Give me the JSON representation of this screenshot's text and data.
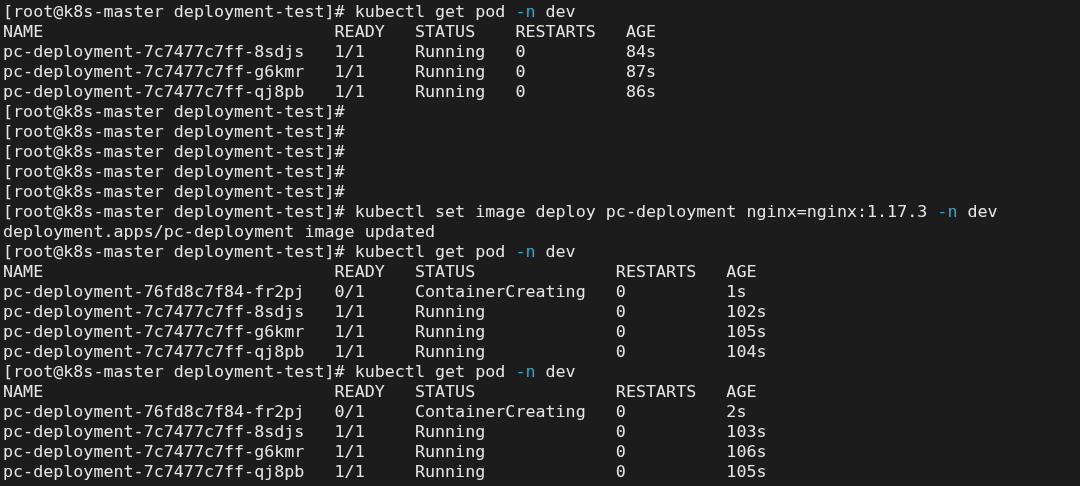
{
  "lines": [
    {
      "kind": "prompt",
      "prompt": "[root@k8s-master deployment-test]#",
      "tokens": [
        {
          "text": "kubectl",
          "kind": "plain"
        },
        {
          "text": "get",
          "kind": "plain"
        },
        {
          "text": "pod",
          "kind": "plain"
        },
        {
          "text": "-n",
          "kind": "flag"
        },
        {
          "text": "dev",
          "kind": "plain"
        }
      ]
    },
    {
      "kind": "output",
      "text": "NAME                             READY   STATUS    RESTARTS   AGE"
    },
    {
      "kind": "output",
      "text": "pc-deployment-7c7477c7ff-8sdjs   1/1     Running   0          84s"
    },
    {
      "kind": "output",
      "text": "pc-deployment-7c7477c7ff-g6kmr   1/1     Running   0          87s"
    },
    {
      "kind": "output",
      "text": "pc-deployment-7c7477c7ff-qj8pb   1/1     Running   0          86s"
    },
    {
      "kind": "prompt",
      "prompt": "[root@k8s-master deployment-test]#"
    },
    {
      "kind": "prompt",
      "prompt": "[root@k8s-master deployment-test]#"
    },
    {
      "kind": "prompt",
      "prompt": "[root@k8s-master deployment-test]#"
    },
    {
      "kind": "prompt",
      "prompt": "[root@k8s-master deployment-test]#"
    },
    {
      "kind": "prompt",
      "prompt": "[root@k8s-master deployment-test]#"
    },
    {
      "kind": "prompt",
      "prompt": "[root@k8s-master deployment-test]#",
      "tokens": [
        {
          "text": "kubectl",
          "kind": "plain"
        },
        {
          "text": "set",
          "kind": "plain"
        },
        {
          "text": "image",
          "kind": "plain"
        },
        {
          "text": "deploy",
          "kind": "plain"
        },
        {
          "text": "pc-deployment",
          "kind": "plain"
        },
        {
          "text": "nginx=nginx:1.17.3",
          "kind": "plain"
        },
        {
          "text": "-n",
          "kind": "flag"
        },
        {
          "text": "dev",
          "kind": "plain"
        }
      ]
    },
    {
      "kind": "output",
      "text": "deployment.apps/pc-deployment image updated"
    },
    {
      "kind": "prompt",
      "prompt": "[root@k8s-master deployment-test]#",
      "tokens": [
        {
          "text": "kubectl",
          "kind": "plain"
        },
        {
          "text": "get",
          "kind": "plain"
        },
        {
          "text": "pod",
          "kind": "plain"
        },
        {
          "text": "-n",
          "kind": "flag"
        },
        {
          "text": "dev",
          "kind": "plain"
        }
      ]
    },
    {
      "kind": "output",
      "text": "NAME                             READY   STATUS              RESTARTS   AGE"
    },
    {
      "kind": "output",
      "text": "pc-deployment-76fd8c7f84-fr2pj   0/1     ContainerCreating   0          1s"
    },
    {
      "kind": "output",
      "text": "pc-deployment-7c7477c7ff-8sdjs   1/1     Running             0          102s"
    },
    {
      "kind": "output",
      "text": "pc-deployment-7c7477c7ff-g6kmr   1/1     Running             0          105s"
    },
    {
      "kind": "output",
      "text": "pc-deployment-7c7477c7ff-qj8pb   1/1     Running             0          104s"
    },
    {
      "kind": "prompt",
      "prompt": "[root@k8s-master deployment-test]#",
      "tokens": [
        {
          "text": "kubectl",
          "kind": "plain"
        },
        {
          "text": "get",
          "kind": "plain"
        },
        {
          "text": "pod",
          "kind": "plain"
        },
        {
          "text": "-n",
          "kind": "flag"
        },
        {
          "text": "dev",
          "kind": "plain"
        }
      ]
    },
    {
      "kind": "output",
      "text": "NAME                             READY   STATUS              RESTARTS   AGE"
    },
    {
      "kind": "output",
      "text": "pc-deployment-76fd8c7f84-fr2pj   0/1     ContainerCreating   0          2s"
    },
    {
      "kind": "output",
      "text": "pc-deployment-7c7477c7ff-8sdjs   1/1     Running             0          103s"
    },
    {
      "kind": "output",
      "text": "pc-deployment-7c7477c7ff-g6kmr   1/1     Running             0          106s"
    },
    {
      "kind": "output",
      "text": "pc-deployment-7c7477c7ff-qj8pb   1/1     Running             0          105s"
    }
  ]
}
